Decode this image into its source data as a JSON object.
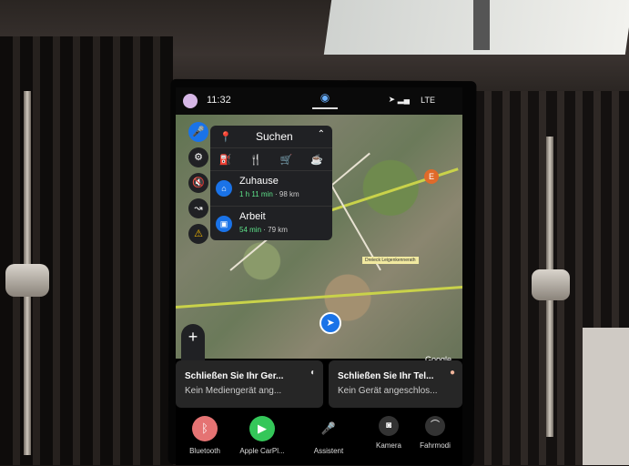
{
  "status": {
    "time": "11:32",
    "network": "LTE"
  },
  "search_panel": {
    "title": "Suchen",
    "categories": [
      "gas-station",
      "restaurant",
      "grocery",
      "coffee"
    ],
    "destinations": [
      {
        "name": "Zuhause",
        "eta": "1 h 11 min",
        "distance": "98 km"
      },
      {
        "name": "Arbeit",
        "eta": "54 min",
        "distance": "79 km"
      }
    ]
  },
  "map": {
    "place_label": "Dreieck Leigenkennerath",
    "poi_letter": "E",
    "attribution": "Google"
  },
  "zoom": {
    "in": "+",
    "out": "−"
  },
  "cards": [
    {
      "title": "Schließen Sie Ihr Ger...",
      "subtitle": "Kein Mediengerät ang..."
    },
    {
      "title": "Schließen Sie Ihr Tel...",
      "subtitle": "Kein Gerät angeschlos..."
    }
  ],
  "dock": [
    {
      "label": "Bluetooth",
      "color": "#e57373"
    },
    {
      "label": "Apple CarPl...",
      "color": "#34c759"
    },
    {
      "label": "Assistent",
      "color": "#4285f4"
    },
    {
      "label": "Kamera",
      "color": "#333333"
    },
    {
      "label": "Fahrmodi",
      "color": "#333333"
    }
  ]
}
